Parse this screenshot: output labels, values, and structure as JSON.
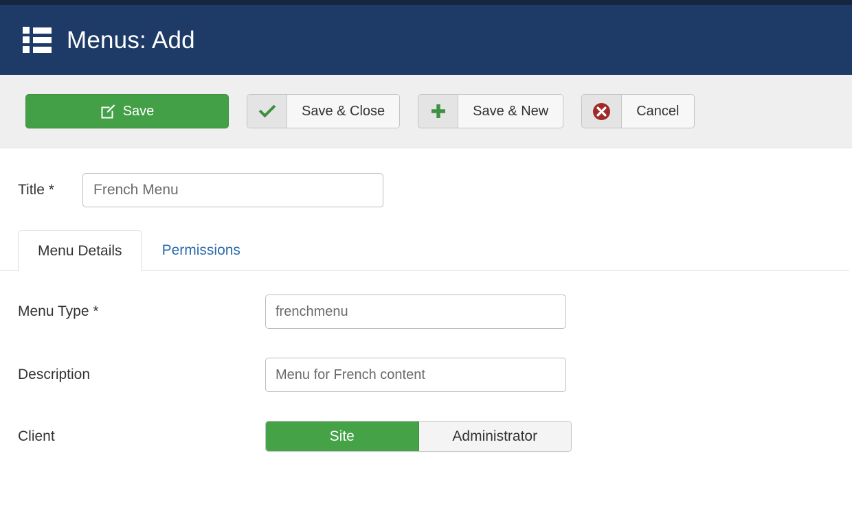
{
  "header": {
    "title": "Menus: Add",
    "icon": "list-icon",
    "bg_color": "#1e3b68",
    "strip_color": "#16263f"
  },
  "toolbar": {
    "save": {
      "label": "Save",
      "icon": "pencil-square-icon",
      "color": "#43a047"
    },
    "save_close": {
      "label": "Save & Close",
      "icon": "check-icon",
      "icon_color": "#3f8f3f"
    },
    "save_new": {
      "label": "Save & New",
      "icon": "plus-icon",
      "icon_color": "#3f9142"
    },
    "cancel": {
      "label": "Cancel",
      "icon": "cancel-circle-icon",
      "icon_color": "#a02a2a"
    }
  },
  "title_field": {
    "label": "Title *",
    "value": "French Menu",
    "placeholder": "French Menu"
  },
  "tabs": [
    {
      "label": "Menu Details",
      "active": true
    },
    {
      "label": "Permissions",
      "active": false
    }
  ],
  "form": {
    "menu_type": {
      "label": "Menu Type *",
      "value": "frenchmenu",
      "placeholder": "frenchmenu"
    },
    "description": {
      "label": "Description",
      "value": "Menu for French content",
      "placeholder": "Menu for French content"
    },
    "client": {
      "label": "Client",
      "options": [
        {
          "label": "Site",
          "selected": true
        },
        {
          "label": "Administrator",
          "selected": false
        }
      ]
    }
  }
}
